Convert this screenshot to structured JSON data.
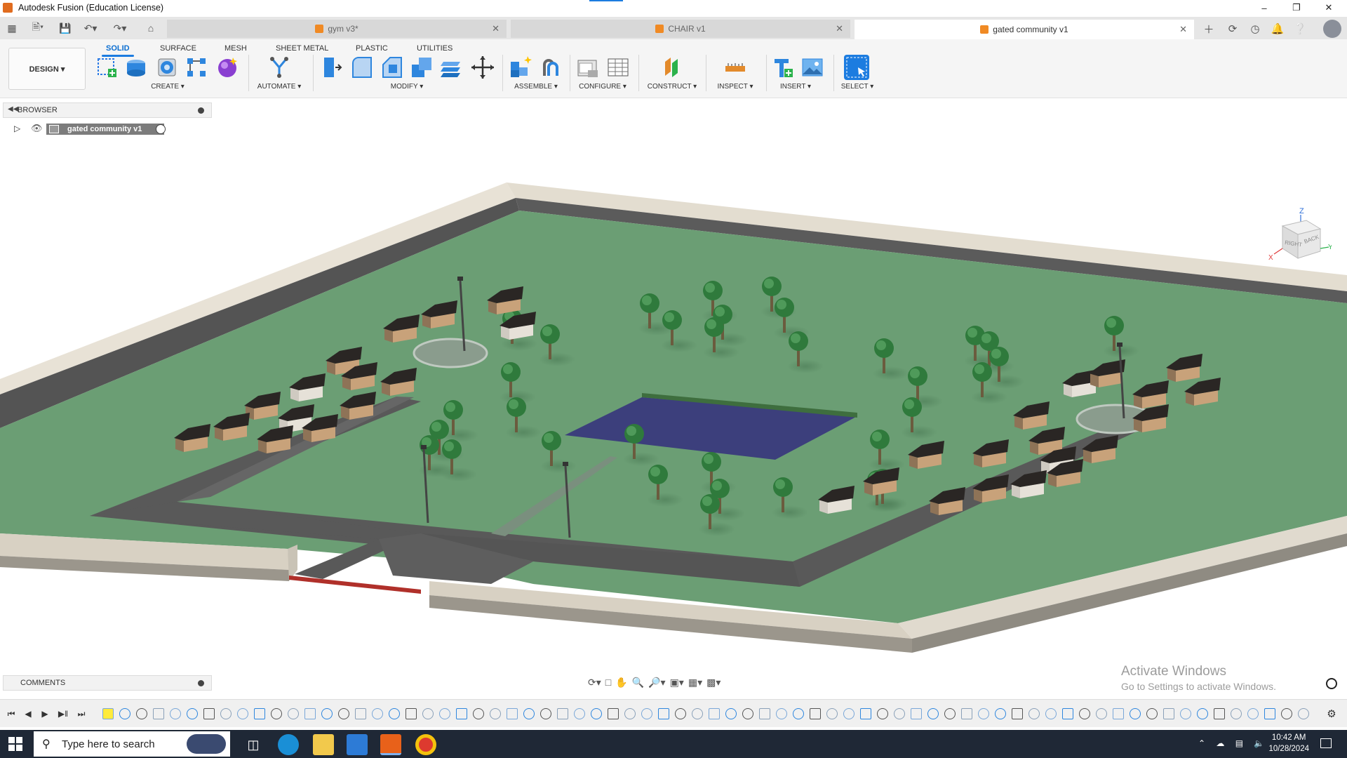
{
  "window": {
    "title": "Autodesk Fusion (Education License)"
  },
  "tabs": [
    {
      "label": "gym v3*",
      "active": false
    },
    {
      "label": "CHAIR v1",
      "active": false
    },
    {
      "label": "gated community v1",
      "active": true
    }
  ],
  "ribbon": {
    "workspace_label": "DESIGN ▾",
    "tabs": [
      "SOLID",
      "SURFACE",
      "MESH",
      "SHEET METAL",
      "PLASTIC",
      "UTILITIES"
    ],
    "active_tab": "SOLID",
    "groups": [
      "CREATE ▾",
      "AUTOMATE ▾",
      "MODIFY ▾",
      "ASSEMBLE ▾",
      "CONFIGURE ▾",
      "CONSTRUCT ▾",
      "INSPECT ▾",
      "INSERT ▾",
      "SELECT ▾"
    ]
  },
  "browser": {
    "title": "BROWSER",
    "root_item": "gated community v1"
  },
  "viewcube": {
    "faces": [
      "RIGHT",
      "BACK"
    ],
    "axes": [
      "Z",
      "Y",
      "X"
    ]
  },
  "comments": {
    "title": "COMMENTS"
  },
  "watermark": {
    "line1": "Activate Windows",
    "line2": "Go to Settings to activate Windows."
  },
  "taskbar": {
    "search_placeholder": "Type here to search",
    "time": "10:42 AM",
    "date": "10/28/2024"
  },
  "colors": {
    "accent": "#1c7ce0",
    "grass": "#6b9e74",
    "road": "#5d5d5d",
    "wall": "#d8d1c3",
    "pond": "#3c3f7c",
    "gate": "#b0302a"
  }
}
